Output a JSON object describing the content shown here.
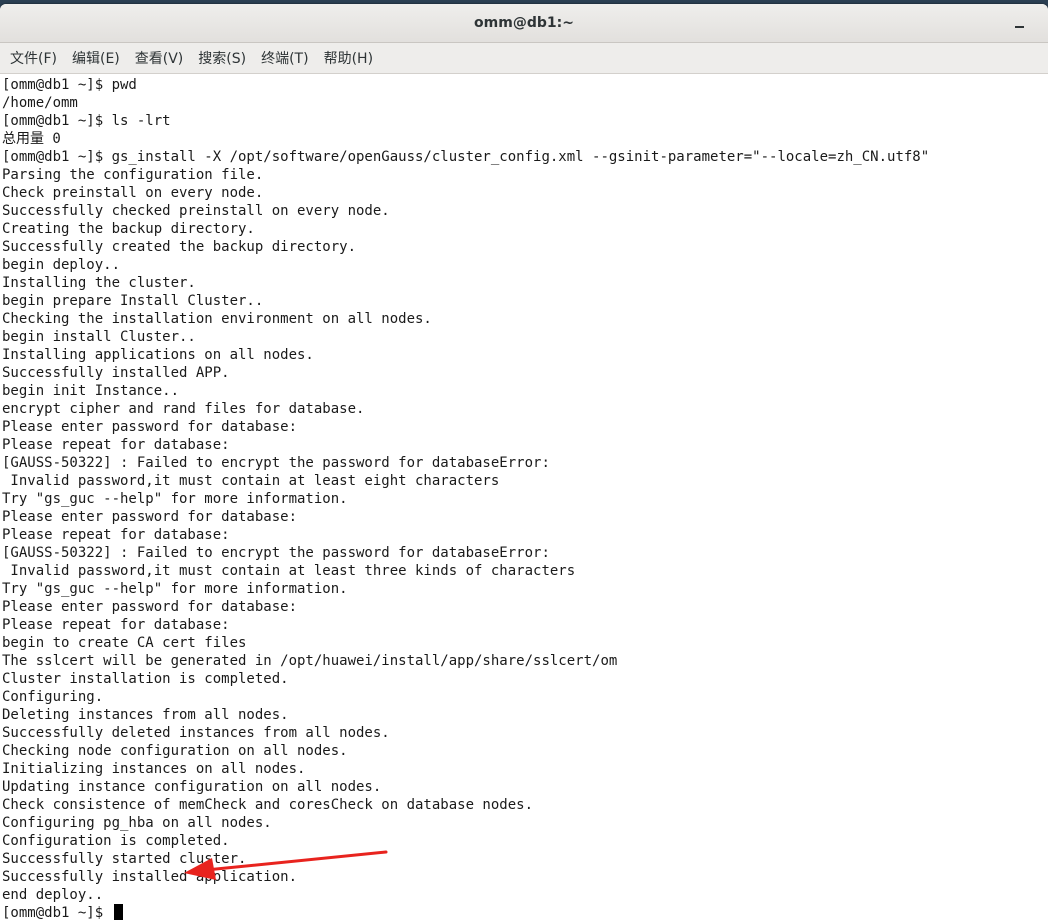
{
  "window": {
    "title": "omm@db1:~"
  },
  "menubar": {
    "items": [
      "文件(F)",
      "编辑(E)",
      "查看(V)",
      "搜索(S)",
      "终端(T)",
      "帮助(H)"
    ]
  },
  "terminal": {
    "lines": [
      "[omm@db1 ~]$ pwd",
      "/home/omm",
      "[omm@db1 ~]$ ls -lrt",
      "总用量 0",
      "[omm@db1 ~]$ gs_install -X /opt/software/openGauss/cluster_config.xml --gsinit-parameter=\"--locale=zh_CN.utf8\"",
      "Parsing the configuration file.",
      "Check preinstall on every node.",
      "Successfully checked preinstall on every node.",
      "Creating the backup directory.",
      "Successfully created the backup directory.",
      "begin deploy..",
      "Installing the cluster.",
      "begin prepare Install Cluster..",
      "Checking the installation environment on all nodes.",
      "begin install Cluster..",
      "Installing applications on all nodes.",
      "Successfully installed APP.",
      "begin init Instance..",
      "encrypt cipher and rand files for database.",
      "Please enter password for database:",
      "Please repeat for database:",
      "[GAUSS-50322] : Failed to encrypt the password for databaseError:",
      " Invalid password,it must contain at least eight characters",
      "Try \"gs_guc --help\" for more information.",
      "Please enter password for database:",
      "Please repeat for database:",
      "[GAUSS-50322] : Failed to encrypt the password for databaseError:",
      " Invalid password,it must contain at least three kinds of characters",
      "Try \"gs_guc --help\" for more information.",
      "Please enter password for database:",
      "Please repeat for database:",
      "begin to create CA cert files",
      "The sslcert will be generated in /opt/huawei/install/app/share/sslcert/om",
      "Cluster installation is completed.",
      "Configuring.",
      "Deleting instances from all nodes.",
      "Successfully deleted instances from all nodes.",
      "Checking node configuration on all nodes.",
      "Initializing instances on all nodes.",
      "Updating instance configuration on all nodes.",
      "Check consistence of memCheck and coresCheck on database nodes.",
      "Configuring pg_hba on all nodes.",
      "Configuration is completed.",
      "Successfully started cluster.",
      "Successfully installed application.",
      "end deploy.."
    ],
    "prompt": "[omm@db1 ~]$ "
  },
  "colors": {
    "annotation_arrow": "#e8231e",
    "desktop_background": "#2b3f52"
  }
}
